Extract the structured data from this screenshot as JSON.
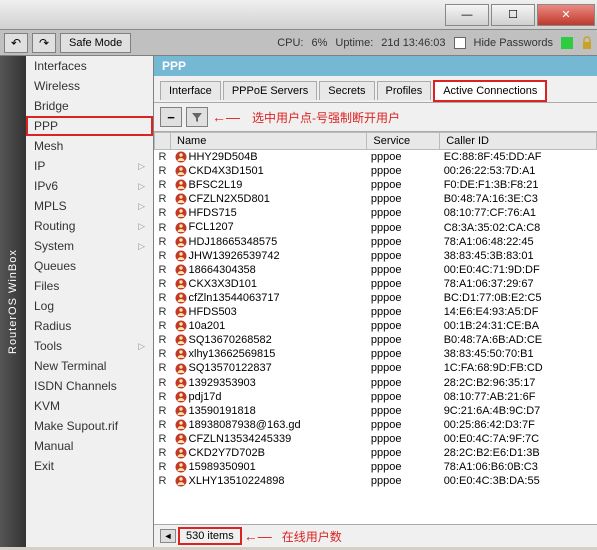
{
  "titlebar": {
    "min": "—",
    "max": "☐",
    "close": "✕"
  },
  "toolbar": {
    "undo": "↶",
    "redo": "↷",
    "safemode": "Safe Mode",
    "cpu_label": "CPU:",
    "cpu_value": "6%",
    "uptime_label": "Uptime:",
    "uptime_value": "21d 13:46:03",
    "hide_pw": "Hide Passwords"
  },
  "vtab": "RouterOS WinBox",
  "sidebar": {
    "items": [
      {
        "label": "Interfaces",
        "sub": false
      },
      {
        "label": "Wireless",
        "sub": false
      },
      {
        "label": "Bridge",
        "sub": false
      },
      {
        "label": "PPP",
        "sub": false,
        "selected": true
      },
      {
        "label": "Mesh",
        "sub": false
      },
      {
        "label": "IP",
        "sub": true
      },
      {
        "label": "IPv6",
        "sub": true
      },
      {
        "label": "MPLS",
        "sub": true
      },
      {
        "label": "Routing",
        "sub": true
      },
      {
        "label": "System",
        "sub": true
      },
      {
        "label": "Queues",
        "sub": false
      },
      {
        "label": "Files",
        "sub": false
      },
      {
        "label": "Log",
        "sub": false
      },
      {
        "label": "Radius",
        "sub": false
      },
      {
        "label": "Tools",
        "sub": true
      },
      {
        "label": "New Terminal",
        "sub": false
      },
      {
        "label": "ISDN Channels",
        "sub": false
      },
      {
        "label": "KVM",
        "sub": false
      },
      {
        "label": "Make Supout.rif",
        "sub": false
      },
      {
        "label": "Manual",
        "sub": false
      },
      {
        "label": "Exit",
        "sub": false
      }
    ]
  },
  "content": {
    "title": "PPP",
    "tabs": [
      {
        "label": "Interface"
      },
      {
        "label": "PPPoE Servers"
      },
      {
        "label": "Secrets"
      },
      {
        "label": "Profiles"
      },
      {
        "label": "Active Connections",
        "active": true
      }
    ],
    "action": {
      "remove": "−",
      "filter": "▼",
      "note": "选中用户点-号强制断开用户"
    },
    "columns": [
      "Name",
      "Service",
      "Caller ID"
    ],
    "rows": [
      {
        "name": "HHY29D504B",
        "svc": "pppoe",
        "cid": "EC:88:8F:45:DD:AF"
      },
      {
        "name": "CKD4X3D1501",
        "svc": "pppoe",
        "cid": "00:26:22:53:7D:A1"
      },
      {
        "name": "BFSC2L19",
        "svc": "pppoe",
        "cid": "F0:DE:F1:3B:F8:21"
      },
      {
        "name": "CFZLN2X5D801",
        "svc": "pppoe",
        "cid": "B0:48:7A:16:3E:C3"
      },
      {
        "name": "HFDS715",
        "svc": "pppoe",
        "cid": "08:10:77:CF:76:A1"
      },
      {
        "name": "FCL1207",
        "svc": "pppoe",
        "cid": "C8:3A:35:02:CA:C8"
      },
      {
        "name": "HDJ18665348575",
        "svc": "pppoe",
        "cid": "78:A1:06:48:22:45"
      },
      {
        "name": "JHW13926539742",
        "svc": "pppoe",
        "cid": "38:83:45:3B:83:01"
      },
      {
        "name": "18664304358",
        "svc": "pppoe",
        "cid": "00:E0:4C:71:9D:DF"
      },
      {
        "name": "CKX3X3D101",
        "svc": "pppoe",
        "cid": "78:A1:06:37:29:67"
      },
      {
        "name": "cfZln13544063717",
        "svc": "pppoe",
        "cid": "BC:D1:77:0B:E2:C5"
      },
      {
        "name": "HFDS503",
        "svc": "pppoe",
        "cid": "14:E6:E4:93:A5:DF"
      },
      {
        "name": "10a201",
        "svc": "pppoe",
        "cid": "00:1B:24:31:CE:BA"
      },
      {
        "name": "SQ13670268582",
        "svc": "pppoe",
        "cid": "B0:48:7A:6B:AD:CE"
      },
      {
        "name": "xlhy13662569815",
        "svc": "pppoe",
        "cid": "38:83:45:50:70:B1"
      },
      {
        "name": "SQ13570122837",
        "svc": "pppoe",
        "cid": "1C:FA:68:9D:FB:CD"
      },
      {
        "name": "13929353903",
        "svc": "pppoe",
        "cid": "28:2C:B2:96:35:17"
      },
      {
        "name": "pdj17d",
        "svc": "pppoe",
        "cid": "08:10:77:AB:21:6F"
      },
      {
        "name": "13590191818",
        "svc": "pppoe",
        "cid": "9C:21:6A:4B:9C:D7"
      },
      {
        "name": "18938087938@163.gd",
        "svc": "pppoe",
        "cid": "00:25:86:42:D3:7F"
      },
      {
        "name": "CFZLN13534245339",
        "svc": "pppoe",
        "cid": "00:E0:4C:7A:9F:7C"
      },
      {
        "name": "CKD2Y7D702B",
        "svc": "pppoe",
        "cid": "28:2C:B2:E6:D1:3B"
      },
      {
        "name": "15989350901",
        "svc": "pppoe",
        "cid": "78:A1:06:B6:0B:C3"
      },
      {
        "name": "XLHY13510224898",
        "svc": "pppoe",
        "cid": "00:E0:4C:3B:DA:55"
      }
    ],
    "status": {
      "count": "530 items",
      "note": "在线用户数"
    }
  }
}
